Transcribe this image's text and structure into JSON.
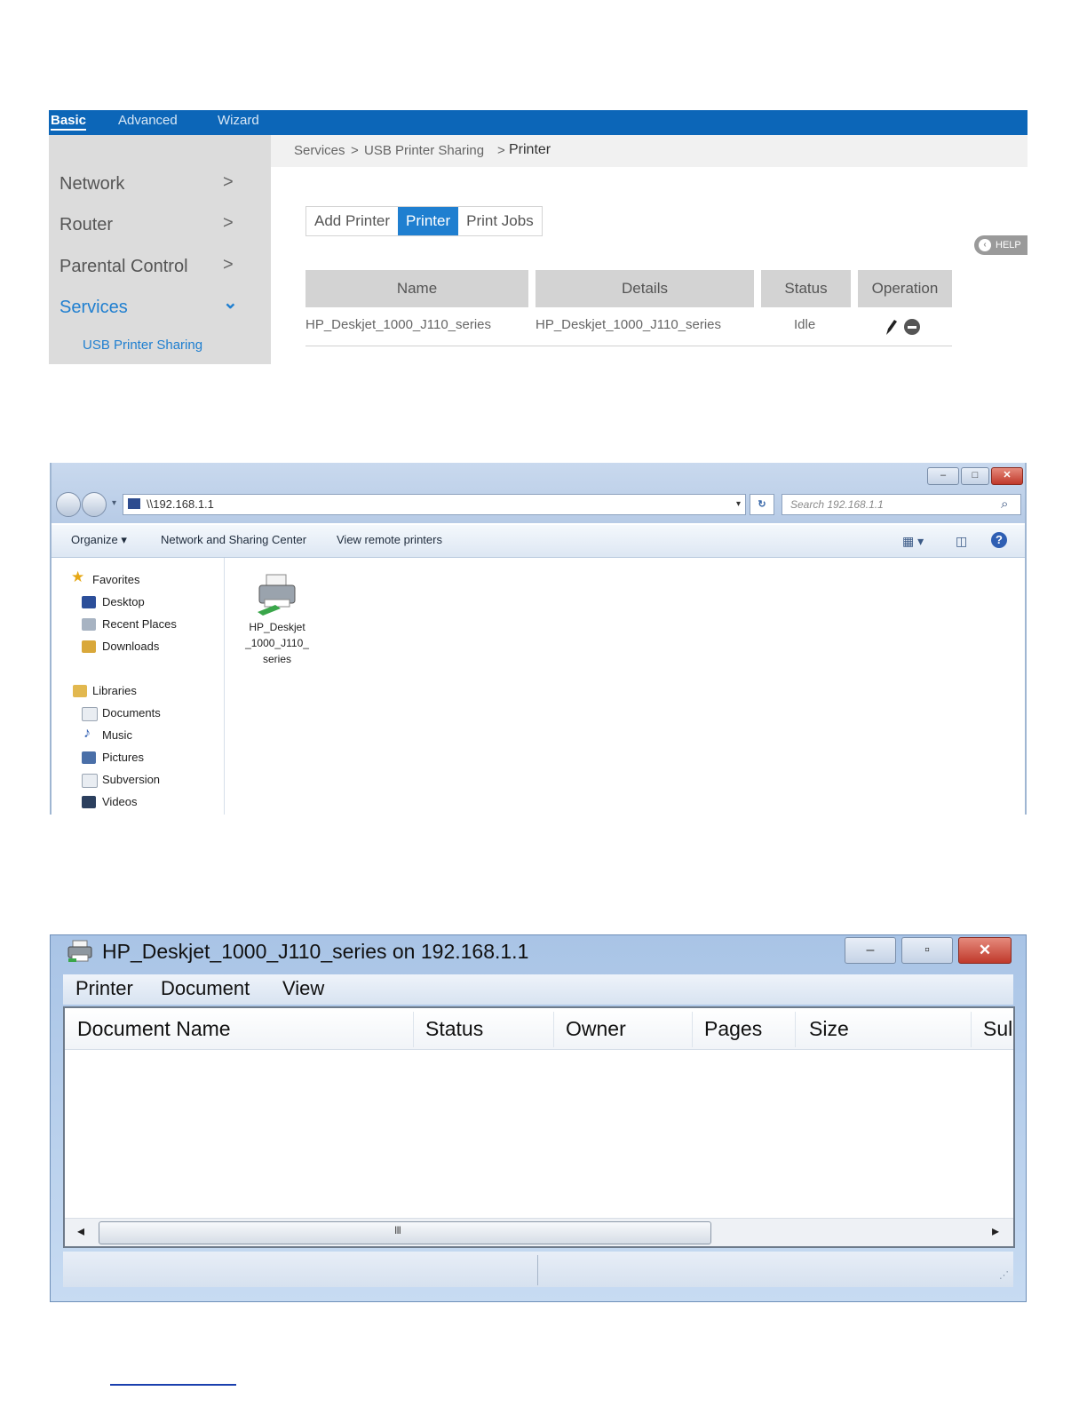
{
  "router": {
    "topnav": [
      "Basic",
      "Advanced",
      "Wizard"
    ],
    "sidebar": [
      {
        "label": "Network",
        "chevron": ">"
      },
      {
        "label": "Router",
        "chevron": ">"
      },
      {
        "label": "Parental Control",
        "chevron": ">"
      },
      {
        "label": "Services",
        "chevron": "⌄"
      }
    ],
    "sidebar_sub": "USB Printer Sharing",
    "breadcrumb": {
      "part1": "Services",
      "sep1": ">",
      "part2": "USB Printer Sharing",
      "sep2": ">",
      "current": "Printer"
    },
    "tabs": [
      "Add Printer",
      "Printer",
      "Print Jobs"
    ],
    "help": "HELP",
    "table": {
      "headers": [
        "Name",
        "Details",
        "Status",
        "Operation"
      ],
      "row": {
        "name": "HP_Deskjet_1000_J110_series",
        "details": "HP_Deskjet_1000_J110_series",
        "status": "Idle"
      }
    }
  },
  "explorer": {
    "address": "\\\\192.168.1.1",
    "search_placeholder": "Search 192.168.1.1",
    "commands": [
      "Organize ▾",
      "Network and Sharing Center",
      "View remote printers"
    ],
    "favorites": {
      "header": "Favorites",
      "items": [
        "Desktop",
        "Recent Places",
        "Downloads"
      ]
    },
    "libraries": {
      "header": "Libraries",
      "items": [
        "Documents",
        "Music",
        "Pictures",
        "Subversion",
        "Videos"
      ]
    },
    "printer_item": {
      "line1": "HP_Deskjet",
      "line2": "_1000_J110_",
      "line3": "series"
    }
  },
  "queue": {
    "title": "HP_Deskjet_1000_J110_series on 192.168.1.1",
    "menu": [
      "Printer",
      "Document",
      "View"
    ],
    "columns": [
      "Document Name",
      "Status",
      "Owner",
      "Pages",
      "Size",
      "Sul"
    ],
    "scroll_grip": "III"
  },
  "colors": {
    "accent": "#1f7fd0",
    "topbar": "#0c66b8",
    "window_frame": "#b7cbe6"
  }
}
